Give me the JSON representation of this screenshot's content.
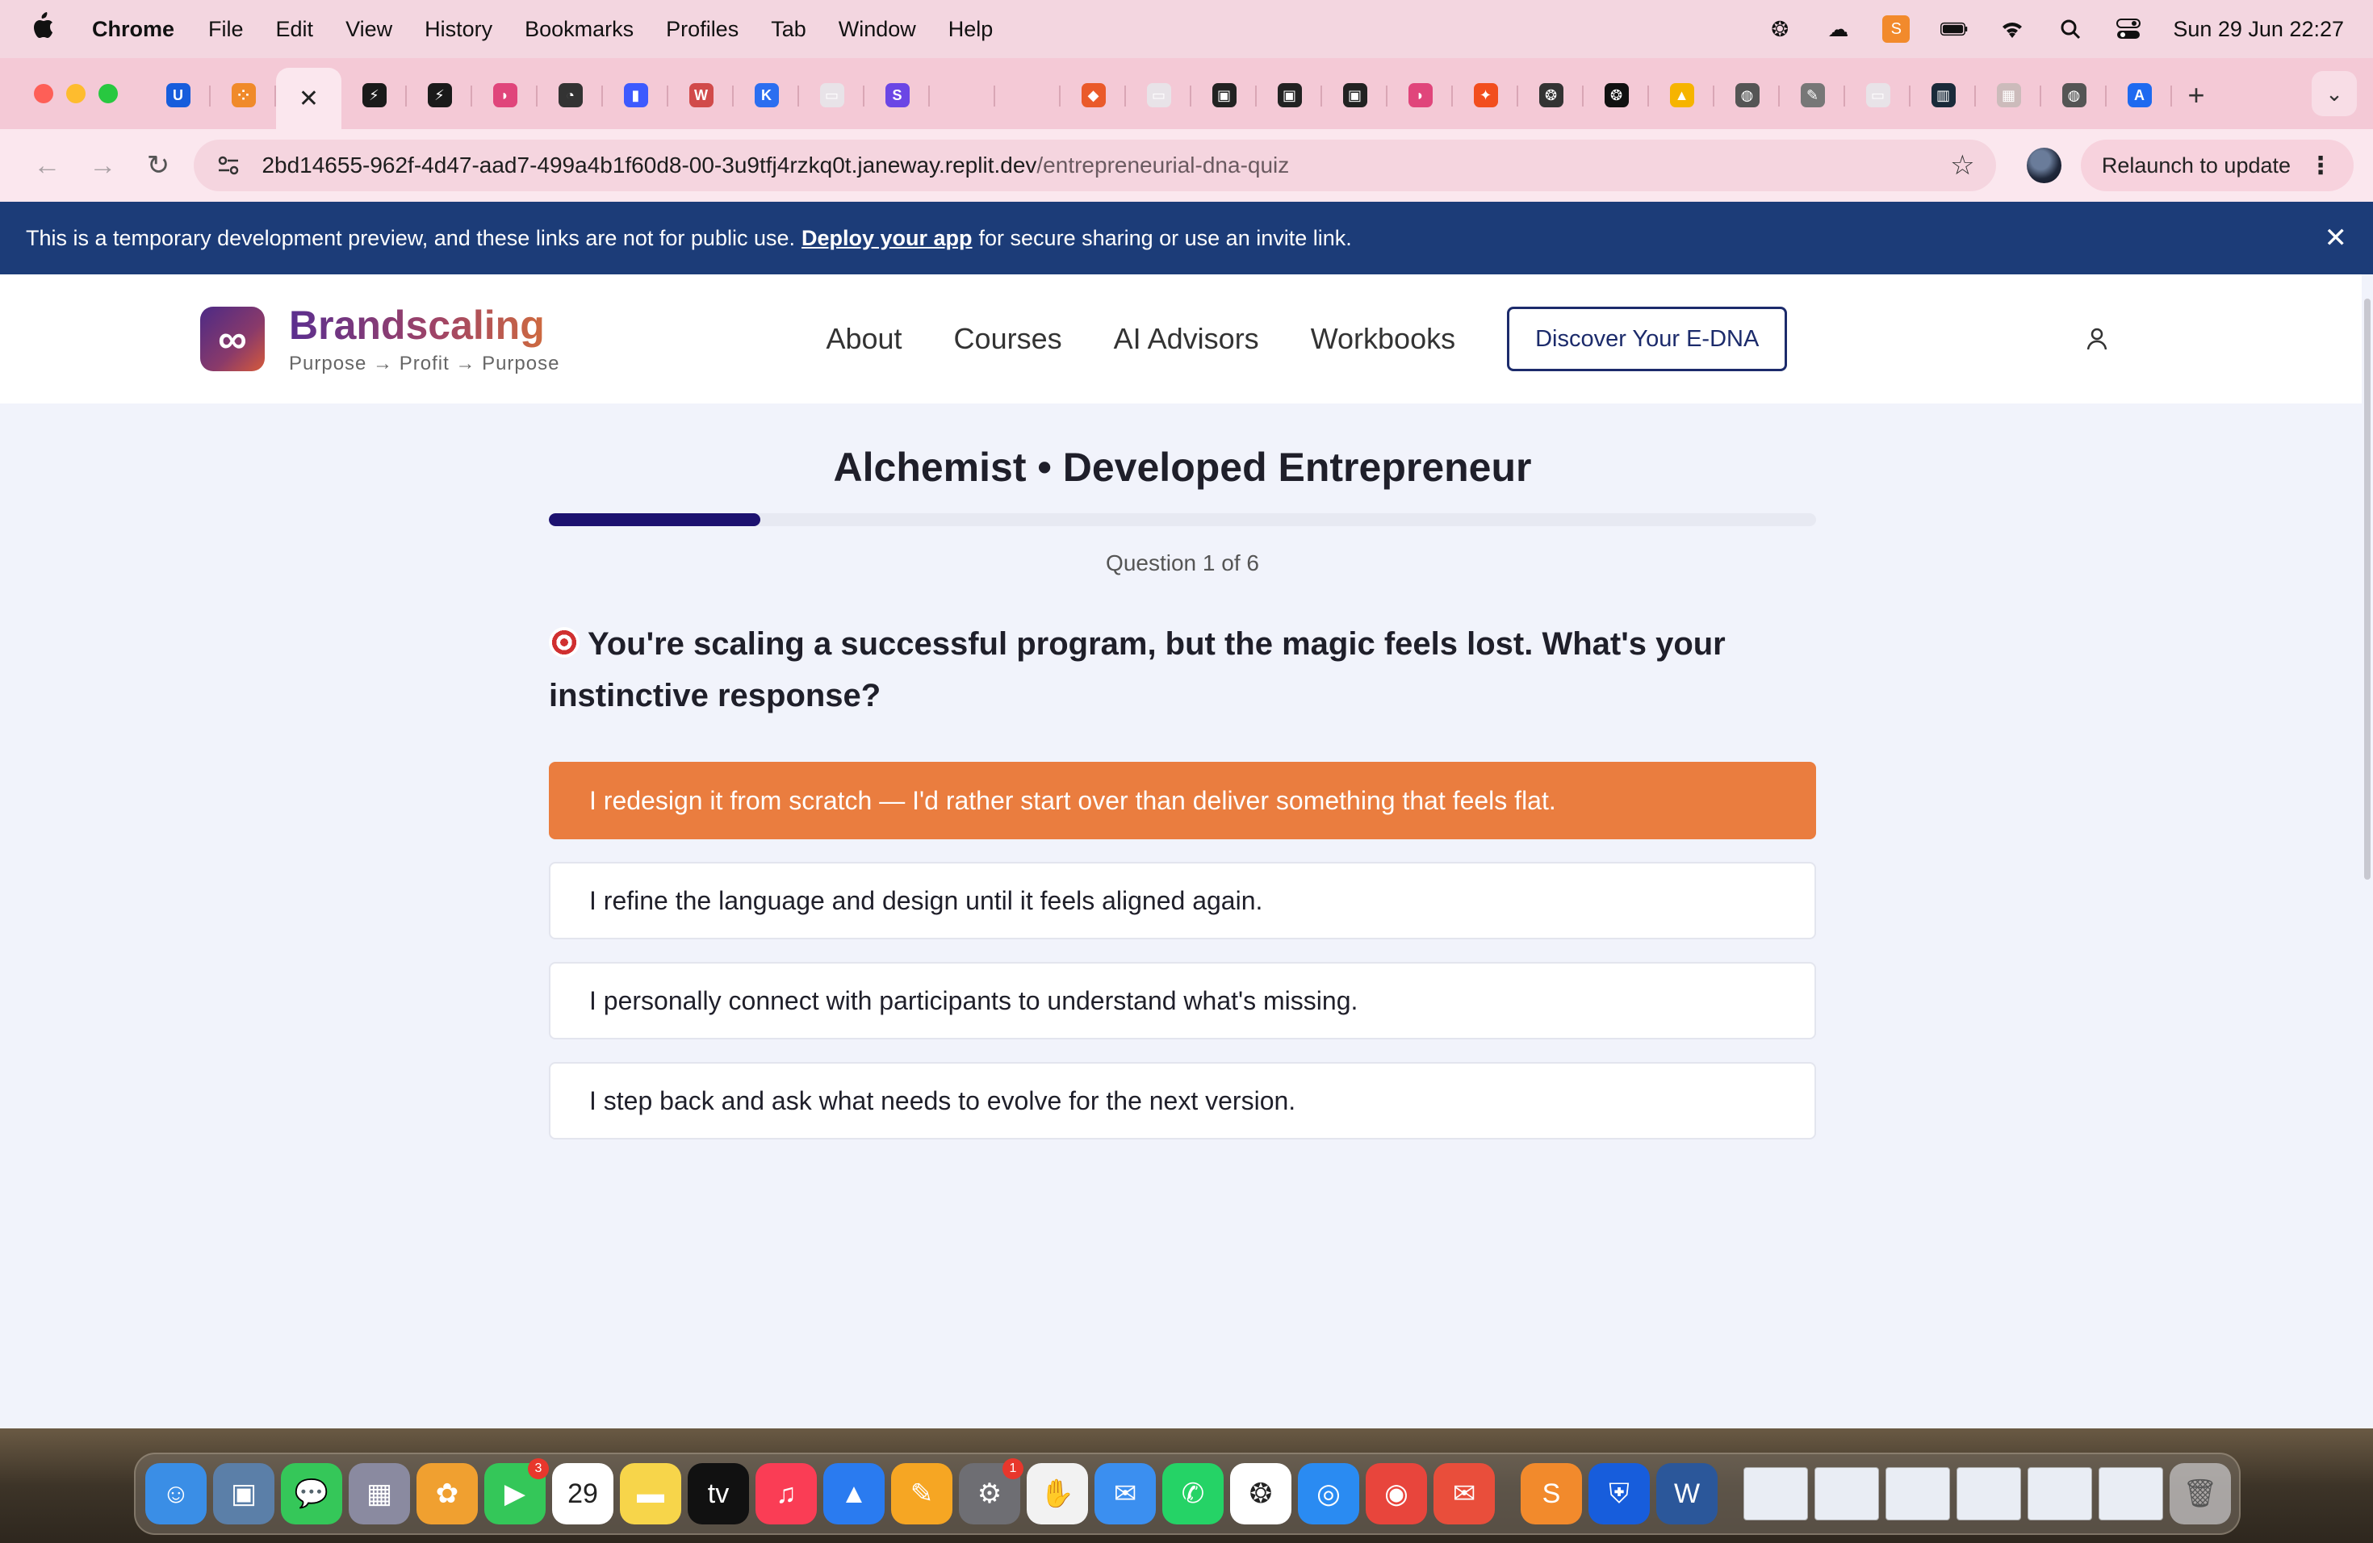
{
  "menubar": {
    "app": "Chrome",
    "items": [
      "File",
      "Edit",
      "View",
      "History",
      "Bookmarks",
      "Profiles",
      "Tab",
      "Window",
      "Help"
    ],
    "clock": "Sun 29 Jun  22:27"
  },
  "tabs": [
    {
      "icon": "bitwarden-icon",
      "label": "U",
      "color": "#175ddc"
    },
    {
      "icon": "grid-dots-icon",
      "label": "⁘",
      "color": "#f08a2a"
    },
    {
      "icon": "close-icon",
      "label": "✕",
      "color": ""
    },
    {
      "icon": "bolt-icon",
      "label": "⚡",
      "color": "#1a1a1a"
    },
    {
      "icon": "bolt-icon",
      "label": "⚡",
      "color": "#1a1a1a"
    },
    {
      "icon": "heart-shape-icon",
      "label": "◗",
      "color": "#e0457b"
    },
    {
      "icon": "gauge-icon",
      "label": "◔",
      "color": "#333"
    },
    {
      "icon": "stripes-icon",
      "label": "▮",
      "color": "#3d5afe"
    },
    {
      "icon": "w-circle-icon",
      "label": "W",
      "color": "#d14a4a"
    },
    {
      "icon": "k-icon",
      "label": "K",
      "color": "#2b6ef0"
    },
    {
      "icon": "image-icon",
      "label": "▭",
      "color": "#e8e3e8"
    },
    {
      "icon": "s-icon",
      "label": "S",
      "color": "#6b46e5"
    },
    {
      "icon": "blank-icon",
      "label": "",
      "color": ""
    },
    {
      "icon": "blank-icon",
      "label": "",
      "color": ""
    },
    {
      "icon": "flame-icon",
      "label": "◆",
      "color": "#ea5a2a"
    },
    {
      "icon": "image-icon",
      "label": "▭",
      "color": "#e8e3e8"
    },
    {
      "icon": "inbox-icon",
      "label": "▣",
      "color": "#222"
    },
    {
      "icon": "inbox-icon",
      "label": "▣",
      "color": "#222"
    },
    {
      "icon": "inbox-icon",
      "label": "▣",
      "color": "#222"
    },
    {
      "icon": "heart-shape-icon",
      "label": "◗",
      "color": "#e0457b"
    },
    {
      "icon": "figma-icon",
      "label": "✦",
      "color": "#f24e1e"
    },
    {
      "icon": "openai-icon",
      "label": "❂",
      "color": "#333"
    },
    {
      "icon": "openai-icon",
      "label": "❂",
      "color": "#111"
    },
    {
      "icon": "drive-icon",
      "label": "▲",
      "color": "#f6b400"
    },
    {
      "icon": "globe-icon",
      "label": "◍",
      "color": "#555"
    },
    {
      "icon": "pen-icon",
      "label": "✎",
      "color": "#777"
    },
    {
      "icon": "image-icon",
      "label": "▭",
      "color": "#e8e3e8"
    },
    {
      "icon": "chart-bars-icon",
      "label": "▥",
      "color": "#1a2a3a"
    },
    {
      "icon": "image-icon",
      "label": "▦",
      "color": "#cbb"
    },
    {
      "icon": "globe-icon",
      "label": "◍",
      "color": "#555"
    },
    {
      "icon": "a-logo-icon",
      "label": "A",
      "color": "#1e6af0"
    }
  ],
  "toolbar": {
    "url_host": "2bd14655-962f-4d47-aad7-499a4b1f60d8-00-3u9tfj4rzkq0t.janeway.replit.dev",
    "url_path": "/entrepreneurial-dna-quiz",
    "relaunch_label": "Relaunch to update"
  },
  "banner": {
    "text_before": "This is a temporary development preview, and these links are not for public use.",
    "link": "Deploy your app",
    "text_after": "for secure sharing or use an invite link."
  },
  "site": {
    "brand_name": "Brandscaling",
    "brand_tagline": "Purpose → Profit → Purpose",
    "logo_symbol": "∞",
    "nav": [
      "About",
      "Courses",
      "AI Advisors",
      "Workbooks"
    ],
    "cta": "Discover Your E-DNA"
  },
  "quiz": {
    "title": "Alchemist • Developed Entrepreneur",
    "progress": 0.1667,
    "counter": "Question 1 of 6",
    "question": "You're scaling a successful program, but the magic feels lost. What's your instinctive response?",
    "answers": [
      {
        "text": "I redesign it from scratch — I'd rather start over than deliver something that feels flat.",
        "selected": true
      },
      {
        "text": "I refine the language and design until it feels aligned again.",
        "selected": false
      },
      {
        "text": "I personally connect with participants to understand what's missing.",
        "selected": false
      },
      {
        "text": "I step back and ask what needs to evolve for the next version.",
        "selected": false
      }
    ]
  },
  "dock": {
    "apps": [
      {
        "name": "finder-icon",
        "glyph": "☺",
        "color": "#3a8ee6"
      },
      {
        "name": "preview-icon",
        "glyph": "▣",
        "color": "#5b7fa8"
      },
      {
        "name": "messages-icon",
        "glyph": "💬",
        "color": "#35c759"
      },
      {
        "name": "launchpad-icon",
        "glyph": "▦",
        "color": "#8a8aa0"
      },
      {
        "name": "photos-icon",
        "glyph": "✿",
        "color": "#f0a030"
      },
      {
        "name": "facetime-icon",
        "glyph": "▶",
        "color": "#34c759",
        "badge": "3"
      },
      {
        "name": "calendar-icon",
        "glyph": "29",
        "color": "#ffffff"
      },
      {
        "name": "notes-icon",
        "glyph": "▬",
        "color": "#f7d54a"
      },
      {
        "name": "apple-tv-icon",
        "glyph": "tv",
        "color": "#111111"
      },
      {
        "name": "music-icon",
        "glyph": "♫",
        "color": "#fa3d55"
      },
      {
        "name": "keynote-icon",
        "glyph": "▲",
        "color": "#2a7bf0"
      },
      {
        "name": "pages-icon",
        "glyph": "✎",
        "color": "#f6a623"
      },
      {
        "name": "system-settings-icon",
        "glyph": "⚙",
        "color": "#6e6e73",
        "badge": "1"
      },
      {
        "name": "raycast-icon",
        "glyph": "✋",
        "color": "#f2f2f2"
      },
      {
        "name": "mail-icon",
        "glyph": "✉",
        "color": "#3b8ff0"
      },
      {
        "name": "whatsapp-icon",
        "glyph": "✆",
        "color": "#25d366"
      },
      {
        "name": "chatgpt-icon",
        "glyph": "❂",
        "color": "#ffffff"
      },
      {
        "name": "safari-icon",
        "glyph": "◎",
        "color": "#2a8bf2"
      },
      {
        "name": "chrome-icon",
        "glyph": "◉",
        "color": "#e8453c"
      },
      {
        "name": "airmail-icon",
        "glyph": "✉",
        "color": "#e94e3b"
      },
      {
        "name": "sublime-icon",
        "glyph": "S",
        "color": "#f28a2c"
      },
      {
        "name": "bitwarden-icon",
        "glyph": "⛨",
        "color": "#175ddc"
      },
      {
        "name": "word-icon",
        "glyph": "W",
        "color": "#2b579a"
      }
    ],
    "trash": "trash-icon"
  }
}
